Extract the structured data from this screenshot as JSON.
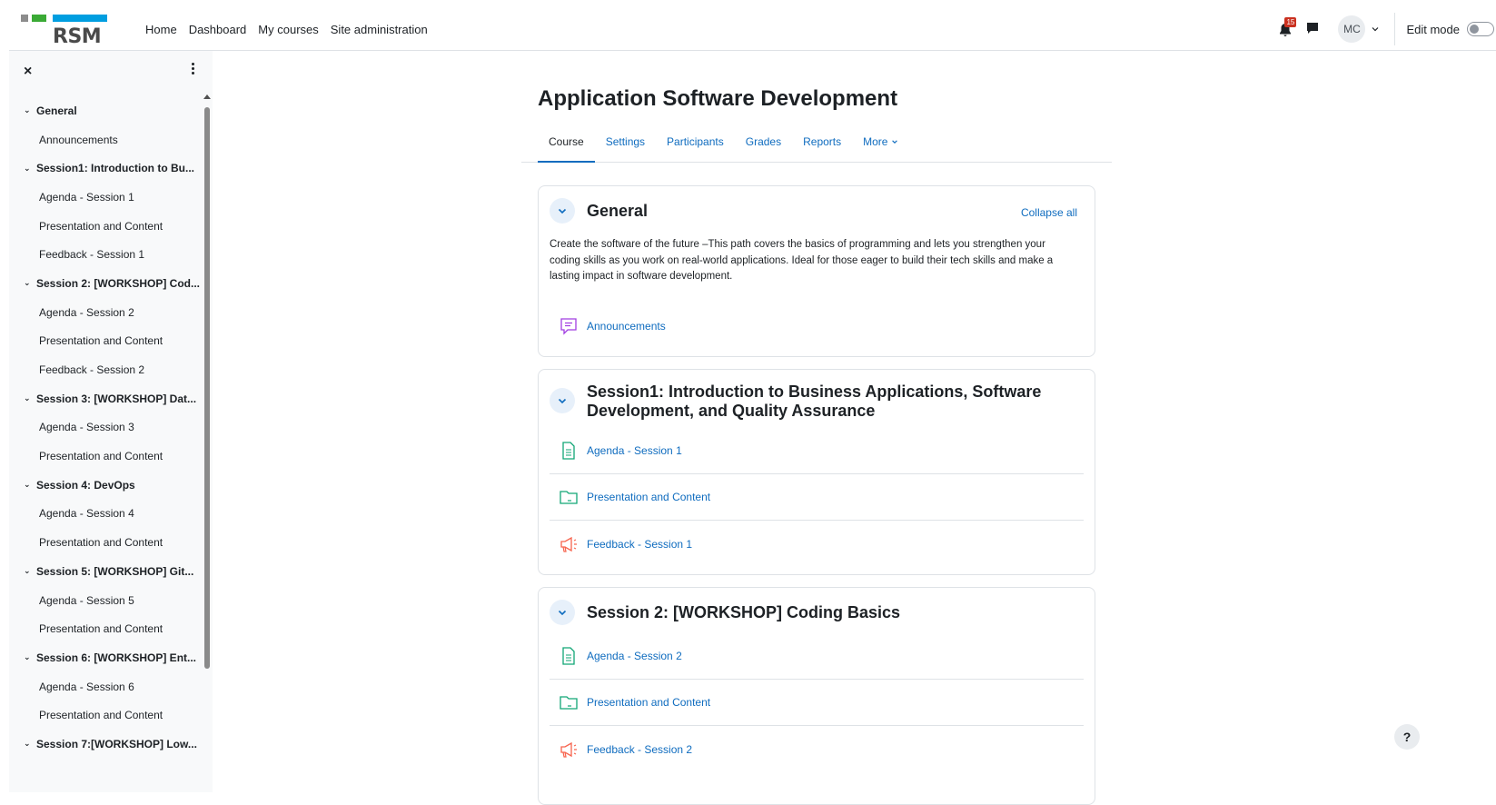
{
  "logo": {
    "text": "RSM"
  },
  "nav": {
    "links": [
      "Home",
      "Dashboard",
      "My courses",
      "Site administration"
    ],
    "notification_count": "15",
    "avatar_initials": "MC",
    "edit_mode_label": "Edit mode",
    "edit_mode_on": false
  },
  "drawer": {
    "close_glyph": "×",
    "items": [
      {
        "type": "section",
        "label": "General"
      },
      {
        "type": "item",
        "label": "Announcements"
      },
      {
        "type": "section",
        "label": "Session1: Introduction to Bu..."
      },
      {
        "type": "item",
        "label": "Agenda - Session 1"
      },
      {
        "type": "item",
        "label": "Presentation and Content"
      },
      {
        "type": "item",
        "label": "Feedback - Session 1"
      },
      {
        "type": "section",
        "label": "Session 2: [WORKSHOP] Cod..."
      },
      {
        "type": "item",
        "label": "Agenda - Session 2"
      },
      {
        "type": "item",
        "label": "Presentation and Content"
      },
      {
        "type": "item",
        "label": "Feedback - Session 2"
      },
      {
        "type": "section",
        "label": "Session 3: [WORKSHOP] Dat..."
      },
      {
        "type": "item",
        "label": "Agenda - Session 3"
      },
      {
        "type": "item",
        "label": "Presentation and Content"
      },
      {
        "type": "section",
        "label": "Session 4: DevOps"
      },
      {
        "type": "item",
        "label": "Agenda - Session 4"
      },
      {
        "type": "item",
        "label": "Presentation and Content"
      },
      {
        "type": "section",
        "label": "Session 5: [WORKSHOP] Git..."
      },
      {
        "type": "item",
        "label": "Agenda - Session 5"
      },
      {
        "type": "item",
        "label": "Presentation and Content"
      },
      {
        "type": "section",
        "label": "Session 6: [WORKSHOP] Ent..."
      },
      {
        "type": "item",
        "label": "Agenda - Session 6"
      },
      {
        "type": "item",
        "label": "Presentation and Content"
      },
      {
        "type": "section",
        "label": "Session 7:[WORKSHOP] Low..."
      }
    ]
  },
  "course": {
    "title": "Application Software Development",
    "tabs": [
      "Course",
      "Settings",
      "Participants",
      "Grades",
      "Reports",
      "More"
    ],
    "active_tab": "Course",
    "collapse_all": "Collapse all",
    "sections": [
      {
        "title": "General",
        "summary": "Create the software of the future –This path covers the basics of programming and lets you strengthen your coding skills as you work on real-world applications. Ideal for those eager to build their tech skills and make a lasting impact in software development.",
        "activities": [
          {
            "label": "Announcements",
            "icon": "forum-icon"
          }
        ]
      },
      {
        "title": "Session1: Introduction to Business Applications, Software Development, and Quality Assurance",
        "activities": [
          {
            "label": "Agenda - Session 1",
            "icon": "page-icon"
          },
          {
            "label": "Presentation and Content",
            "icon": "folder-icon"
          },
          {
            "label": "Feedback - Session 1",
            "icon": "feedback-icon"
          }
        ]
      },
      {
        "title": "Session 2: [WORKSHOP] Coding Basics",
        "activities": [
          {
            "label": "Agenda - Session 2",
            "icon": "page-icon"
          },
          {
            "label": "Presentation and Content",
            "icon": "folder-icon"
          },
          {
            "label": "Feedback - Session 2",
            "icon": "feedback-icon"
          }
        ]
      }
    ]
  },
  "help": {
    "glyph": "?"
  },
  "colors": {
    "link": "#0f6cbf",
    "forum_icon": "#a13ee1",
    "resource_icon": "#11a676",
    "feedback_icon": "#f7634d",
    "badge": "#ca3120"
  }
}
